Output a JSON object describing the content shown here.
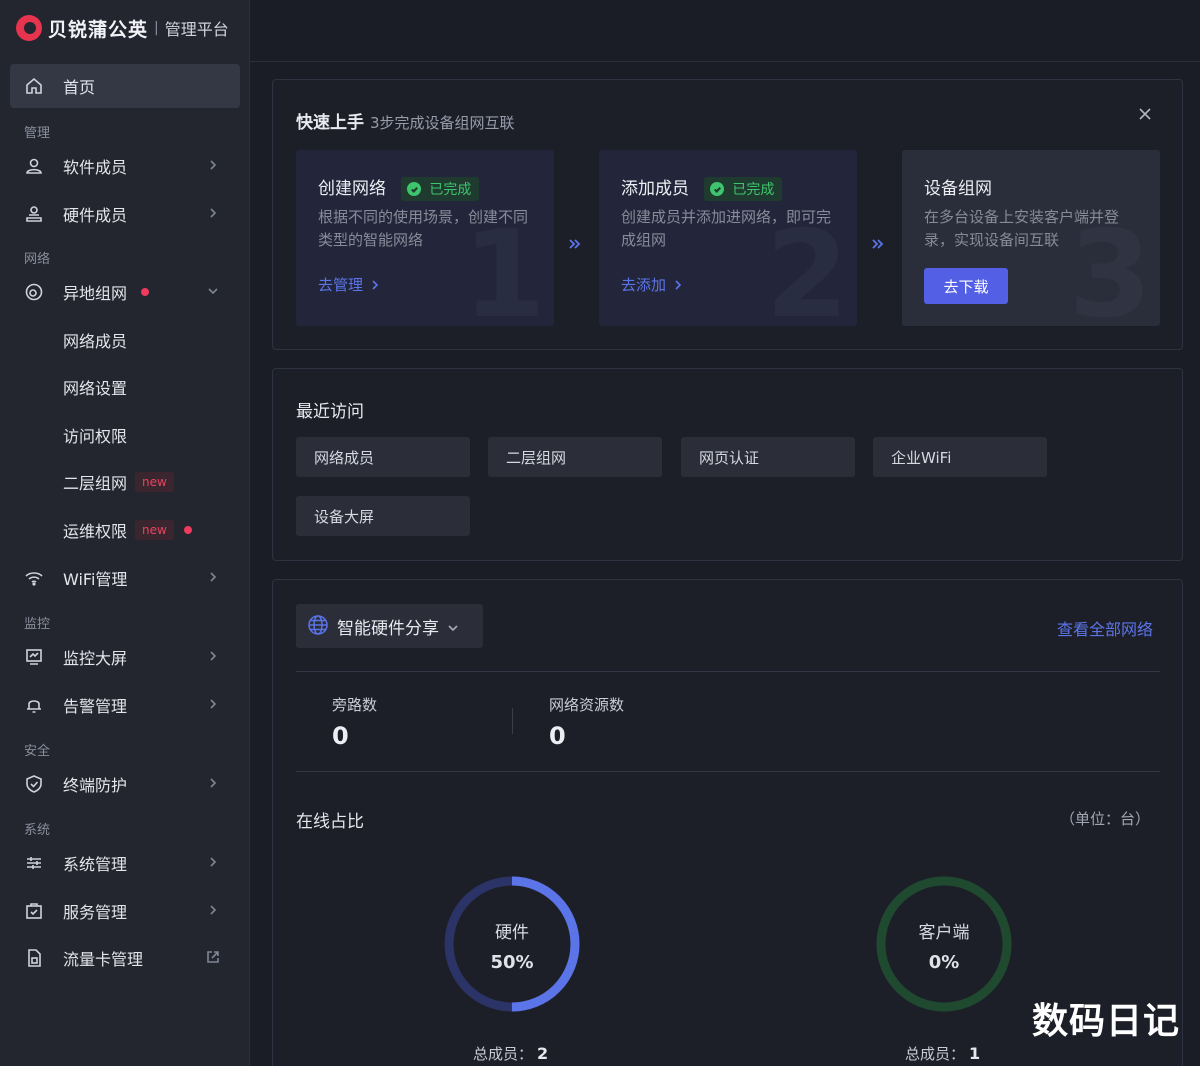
{
  "brand": {
    "name": "贝锐蒲公英",
    "separator": "|",
    "subtitle": "管理平台"
  },
  "sidebar": {
    "home": "首页",
    "groups": {
      "manage": "管理",
      "network": "网络",
      "monitor": "监控",
      "security": "安全",
      "system": "系统"
    },
    "items": {
      "software_members": "软件成员",
      "hardware_members": "硬件成员",
      "remote_network": "异地组网",
      "network_members": "网络成员",
      "network_settings": "网络设置",
      "access_permissions": "访问权限",
      "layer2_network": "二层组网",
      "ops_permissions": "运维权限",
      "wifi_management": "WiFi管理",
      "monitor_screen": "监控大屏",
      "alert_management": "告警管理",
      "endpoint_protection": "终端防护",
      "system_management": "系统管理",
      "service_management": "服务管理",
      "traffic_card": "流量卡管理"
    },
    "new_badge": "new"
  },
  "quickstart": {
    "title": "快速上手",
    "subtitle": "3步完成设备组网互联",
    "steps": [
      {
        "title": "创建网络",
        "badge": "已完成",
        "desc": "根据不同的使用场景，创建不同类型的智能网络",
        "action": "去管理",
        "num": "1"
      },
      {
        "title": "添加成员",
        "badge": "已完成",
        "desc": "创建成员并添加进网络，即可完成组网",
        "action": "去添加",
        "num": "2"
      },
      {
        "title": "设备组网",
        "desc": "在多台设备上安装客户端并登录，实现设备间互联",
        "action": "去下载",
        "num": "3"
      }
    ]
  },
  "recent": {
    "title": "最近访问",
    "items": [
      "网络成员",
      "二层组网",
      "网页认证",
      "企业WiFi",
      "设备大屏"
    ]
  },
  "network_panel": {
    "selected_network": "智能硬件分享",
    "view_all": "查看全部网络",
    "stats": [
      {
        "label": "旁路数",
        "value": "0"
      },
      {
        "label": "网络资源数",
        "value": "0"
      }
    ],
    "online_title": "在线占比",
    "unit": "（单位：台）",
    "donuts": [
      {
        "label": "硬件",
        "percent": "50%",
        "fraction": 0.5,
        "total_label": "总成员：",
        "total": "2",
        "color": "#5b74e8",
        "track": "#2c3366"
      },
      {
        "label": "客户端",
        "percent": "0%",
        "fraction": 0,
        "total_label": "总成员：",
        "total": "1",
        "color": "#2fae5b",
        "track": "#1f4a2f"
      }
    ]
  },
  "watermark": "数码日记"
}
